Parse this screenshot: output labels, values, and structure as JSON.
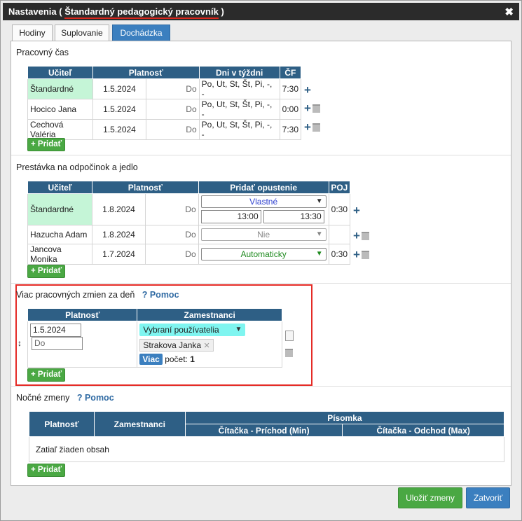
{
  "titlebar": {
    "prefix": "Nastavenia ( ",
    "highlight": "Štandardný pedagogický pracovník",
    "suffix": " )",
    "close": "✖"
  },
  "tabs": [
    "Hodiny",
    "Suplovanie",
    "Dochádzka"
  ],
  "work": {
    "title": "Pracovný čas",
    "headers": [
      "Učiteľ",
      "Platnosť",
      "Dni v týždni",
      "ČF"
    ],
    "rows": [
      {
        "teacher": "Štandardné",
        "from": "1.5.2024",
        "to": "Do",
        "days": "Po, Ut, St, Št, Pi, -, -",
        "cf": "7:30"
      },
      {
        "teacher": "Hocico Jana",
        "from": "1.5.2024",
        "to": "Do",
        "days": "Po, Ut, St, Št, Pi, -, -",
        "cf": "0:00"
      },
      {
        "teacher": "Cechová Valéria",
        "from": "1.5.2024",
        "to": "Do",
        "days": "Po, Ut, St, Št, Pi, -, -",
        "cf": "7:30"
      }
    ],
    "add": "+ Pridať"
  },
  "breaks": {
    "title": "Prestávka na odpočinok a jedlo",
    "headers": [
      "Učiteľ",
      "Platnosť",
      "Pridať opustenie",
      "POJ"
    ],
    "rows": [
      {
        "teacher": "Štandardné",
        "from": "1.8.2024",
        "to": "Do",
        "mode": "Vlastné",
        "start": "13:00",
        "end": "13:30",
        "poj": "0:30"
      },
      {
        "teacher": "Hazucha Adam",
        "from": "1.8.2024",
        "to": "Do",
        "mode": "Nie",
        "poj": ""
      },
      {
        "teacher": "Jancova Monika",
        "from": "1.7.2024",
        "to": "Do",
        "mode": "Automaticky",
        "poj": "0:30"
      }
    ],
    "add": "+ Pridať"
  },
  "multi": {
    "title": "Viac pracovných zmien za deň",
    "help": "? Pomoc",
    "headers": [
      "Platnosť",
      "Zamestnanci"
    ],
    "from": "1.5.2024",
    "to_placeholder": "Do",
    "select": "Vybraní používatelia",
    "chip": "Strakova Janka",
    "more": "Viac",
    "count_label": "počet:",
    "count": "1",
    "drag": "↕",
    "add": "+ Pridať"
  },
  "night": {
    "title": "Nočné zmeny",
    "help": "? Pomoc",
    "headers": [
      "Platnosť",
      "Zamestnanci",
      "Písomka"
    ],
    "sub_headers": [
      "Čítačka - Príchod (Min)",
      "Čítačka - Odchod (Max)"
    ],
    "empty": "Zatiaľ žiaden obsah",
    "add": "+ Pridať"
  },
  "footer": {
    "save": "Uložiť zmeny",
    "close": "Zatvoriť"
  },
  "colors": {
    "header": "#2e5f85",
    "accent": "#3b7fbf",
    "green": "#4aa843",
    "highlight": "#e52b26",
    "std_cell": "#c5f5d7",
    "cyan_select": "#7ff5f0"
  }
}
